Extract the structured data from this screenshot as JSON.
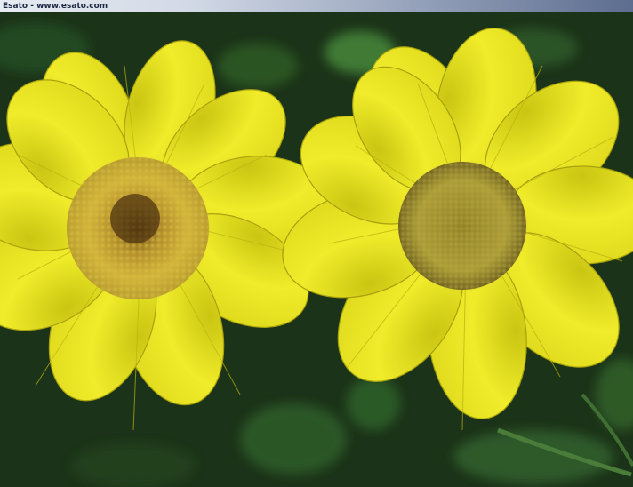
{
  "watermark": {
    "text": "Esato - www.esato.com"
  },
  "photo": {
    "subject": "two-yellow-daisy-like-flowers",
    "colors": {
      "petal": "#e9e41d",
      "petal_shadow": "#a8a80c",
      "disc": "#b3a82f",
      "disc_center": "#6a5a14",
      "foliage": "#1c3a1a"
    }
  }
}
